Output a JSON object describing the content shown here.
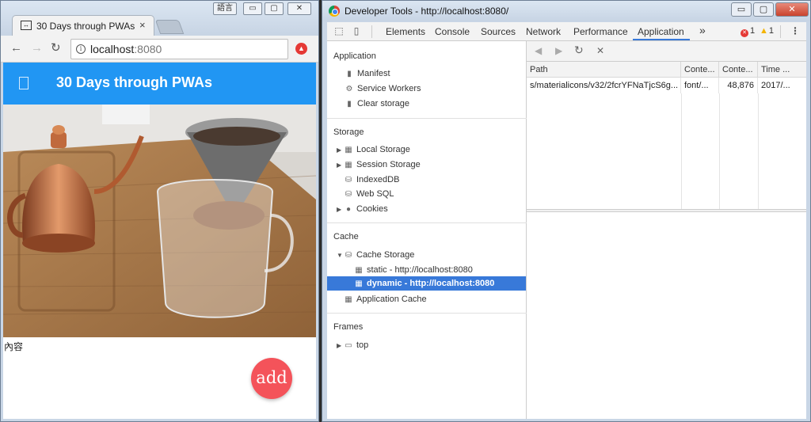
{
  "browser": {
    "ime_label": "語言",
    "tab_title": "30 Days through PWAs",
    "tab_close": "×",
    "url_host": "localhost",
    "url_port": ":8080",
    "app": {
      "title": "30 Days through PWAs",
      "content_text": "內容",
      "fab_label": "add",
      "header_color": "#2196f3",
      "fab_color": "#f4535a"
    }
  },
  "devtools": {
    "window_title": "Developer Tools - http://localhost:8080/",
    "tabs": [
      "Elements",
      "Console",
      "Sources",
      "Network",
      "Performance",
      "Application"
    ],
    "active_tab": "Application",
    "more_tabs": "»",
    "error_count": "1",
    "warning_count": "1",
    "sidebar": {
      "application": {
        "heading": "Application",
        "items": [
          "Manifest",
          "Service Workers",
          "Clear storage"
        ]
      },
      "storage": {
        "heading": "Storage",
        "items": [
          "Local Storage",
          "Session Storage",
          "IndexedDB",
          "Web SQL",
          "Cookies"
        ]
      },
      "cache": {
        "heading": "Cache",
        "cache_storage": "Cache Storage",
        "entries": [
          "static - http://localhost:8080",
          "dynamic - http://localhost:8080"
        ],
        "selected": "dynamic - http://localhost:8080",
        "app_cache": "Application Cache"
      },
      "frames": {
        "heading": "Frames",
        "items": [
          "top"
        ]
      }
    },
    "cache_table": {
      "columns": [
        "Path",
        "Conte...",
        "Conte...",
        "Time ..."
      ],
      "rows": [
        [
          "s/materialicons/v32/2fcrYFNaTjcS6g...",
          "font/...",
          "48,876",
          "2017/..."
        ]
      ]
    },
    "accent_color": "#3879d9"
  }
}
